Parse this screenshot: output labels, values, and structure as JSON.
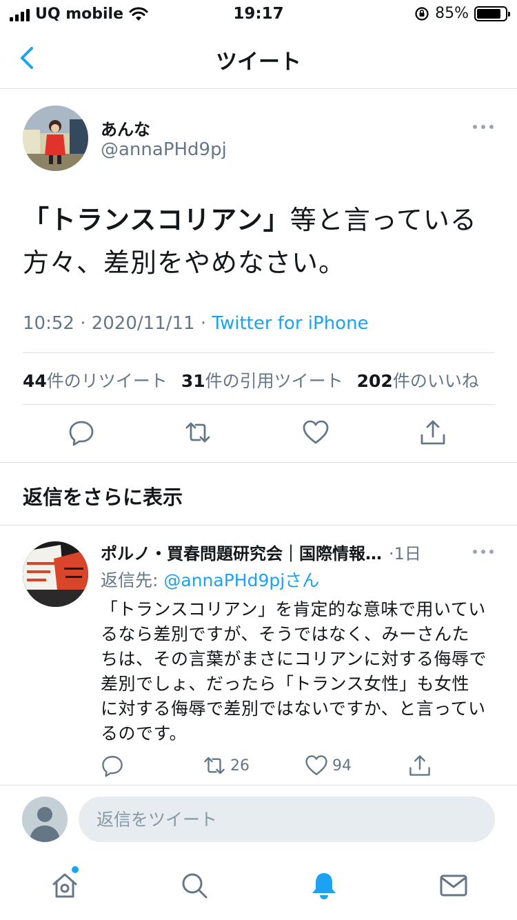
{
  "status_bar": {
    "carrier": "UQ mobile",
    "time": "19:17",
    "battery": "85%",
    "battery_level": 0.85
  },
  "nav": {
    "title": "ツイート"
  },
  "tweet": {
    "author_name": "あんな",
    "author_handle": "@annaPHd9pj",
    "text_bold": "「トランスコリアン」",
    "text_rest_line1": "等と言っている",
    "text_line2": "方々、差別をやめなさい。",
    "meta_time": "10:52 · 2020/11/11 · ",
    "meta_source": "Twitter for iPhone",
    "stats": {
      "retweets_count": "44",
      "retweets_label": "件のリツイート",
      "quotes_count": "31",
      "quotes_label": "件の引用ツイート",
      "likes_count": "202",
      "likes_label": "件のいいね"
    }
  },
  "more_replies_heading": "返信をさらに表示",
  "reply": {
    "author_name": "ポルノ・買春問題研究会｜国際情報…",
    "time": "·1日",
    "reply_to_prefix": "返信先: ",
    "reply_to_handle": "@annaPHd9pjさん",
    "text": "「トランスコリアン」を肯定的な意味で用いているなら差別ですが、そうではなく、みーさんたちは、その言葉がまさにコリアンに対する侮辱で差別でしょ、だったら「トランス女性」も女性に対する侮辱で差別ではないですか、と言っているのです。",
    "retweets": "26",
    "likes": "94"
  },
  "composer": {
    "placeholder": "返信をツイート"
  },
  "colors": {
    "accent": "#1da1f2",
    "secondary_text": "#657786",
    "divider": "#dcdfe2"
  },
  "icons": [
    "back-chevron-icon",
    "more-icon",
    "reply-icon",
    "retweet-icon",
    "like-icon",
    "share-icon",
    "home-icon",
    "search-icon",
    "notifications-icon",
    "messages-icon"
  ]
}
